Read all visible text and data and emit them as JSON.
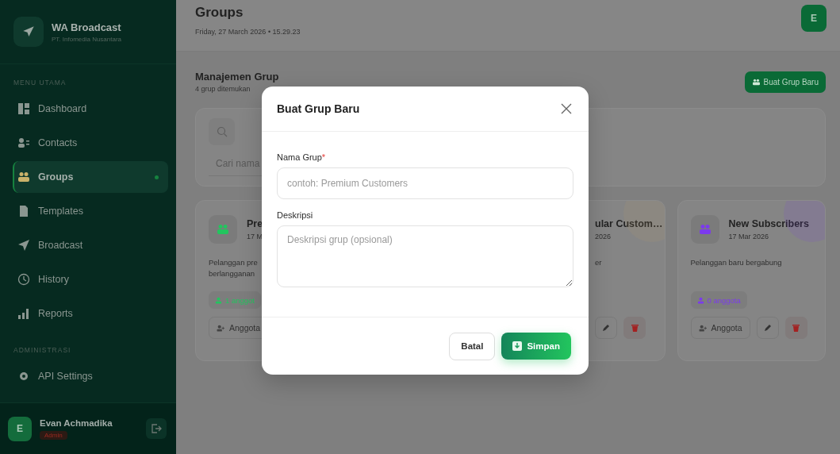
{
  "sidebar": {
    "app_name": "WA Broadcast",
    "company": "PT. Infomedia Nusantara",
    "sections": [
      {
        "heading": "MENU UTAMA",
        "items": [
          {
            "label": "Dashboard",
            "selected": false
          },
          {
            "label": "Contacts",
            "selected": false
          },
          {
            "label": "Groups",
            "selected": true
          },
          {
            "label": "Templates",
            "selected": false
          },
          {
            "label": "Broadcast",
            "selected": false
          },
          {
            "label": "History",
            "selected": false
          },
          {
            "label": "Reports",
            "selected": false
          }
        ]
      },
      {
        "heading": "ADMINISTRASI",
        "items": [
          {
            "label": "API Settings",
            "selected": false
          }
        ]
      }
    ],
    "user": {
      "initial": "E",
      "name": "Evan Achmadika",
      "role": "Admin"
    }
  },
  "header": {
    "title": "Groups",
    "datetime": "Friday, 27 March 2026 • 15.29.23",
    "avatar_initial": "E"
  },
  "groups_section": {
    "title": "Manajemen Grup",
    "count": "4 grup ditemukan",
    "new_button": "Buat Grup Baru",
    "search_placeholder": "Cari nama",
    "cards": [
      {
        "kind": "left",
        "color": "#22c55e",
        "name": "Pre",
        "date": "17 M",
        "description_lines": [
          "Pelanggan pre",
          "berlangganan"
        ],
        "badge": "1 anggot",
        "buttons": [
          {
            "kind": "members",
            "label": "Anggota"
          }
        ]
      },
      {
        "kind": "clipped",
        "name": "ular Custom…",
        "date": "2026",
        "description_lines": [
          "er"
        ],
        "buttons": [
          {
            "kind": "edit"
          },
          {
            "kind": "delete"
          }
        ]
      },
      {
        "kind": "full",
        "color": "#7c3aed",
        "name": "New Subscribers",
        "date": "17 Mar 2026",
        "description_lines": [
          "Pelanggan baru bergabung"
        ],
        "badge": "0 anggota",
        "buttons": [
          {
            "kind": "members",
            "label": "Anggota"
          },
          {
            "kind": "edit"
          },
          {
            "kind": "delete"
          }
        ]
      }
    ]
  },
  "modal": {
    "title": "Buat Grup Baru",
    "fields": [
      {
        "kind": "input",
        "label": "Nama Grup",
        "required_mark": "*",
        "placeholder": "contoh: Premium Customers"
      },
      {
        "kind": "textarea",
        "label": "Deskripsi",
        "placeholder": "Deskripsi grup (opsional)"
      }
    ],
    "cancel": "Batal",
    "save": "Simpan"
  }
}
